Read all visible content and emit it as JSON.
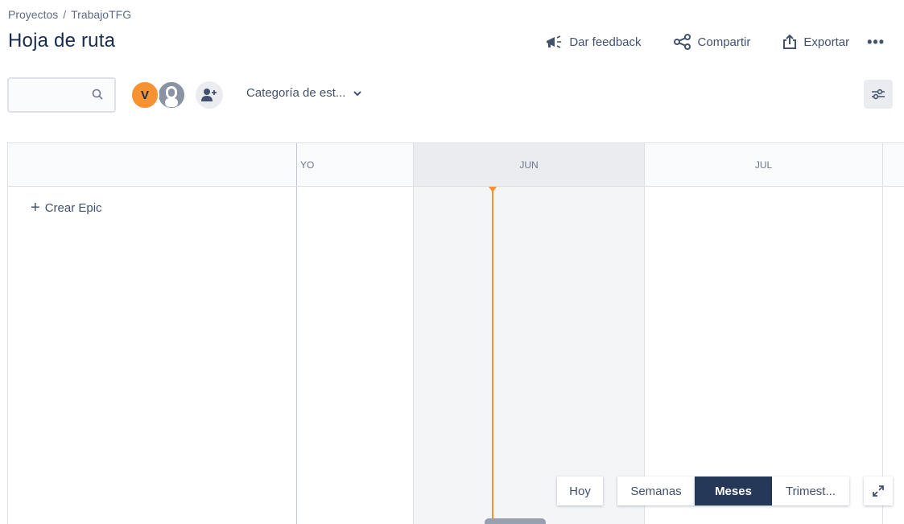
{
  "breadcrumb": {
    "project": "Proyectos",
    "separator": "/",
    "current": "TrabajoTFG"
  },
  "title": "Hoja de ruta",
  "header_actions": {
    "feedback": "Dar feedback",
    "share": "Compartir",
    "export": "Exportar",
    "more": "•••"
  },
  "search": {
    "placeholder": "",
    "value": ""
  },
  "avatars": {
    "initial": "V"
  },
  "filter": {
    "category_label": "Categoría de est..."
  },
  "timeline": {
    "months": [
      "YO",
      "JUN",
      "JUL"
    ],
    "create_epic": "Crear Epic"
  },
  "view_controls": {
    "today": "Hoy",
    "weeks": "Semanas",
    "months": "Meses",
    "quarters": "Trimest...",
    "active": "Meses"
  },
  "colors": {
    "accent": "#f79232",
    "active_tab": "#253858",
    "text": "#172b4d"
  },
  "icons": [
    "search-icon",
    "megaphone-icon",
    "share-icon",
    "export-icon",
    "more-icon",
    "add-person-icon",
    "chevron-down-icon",
    "view-settings-icon",
    "plus-icon",
    "expand-icon"
  ]
}
